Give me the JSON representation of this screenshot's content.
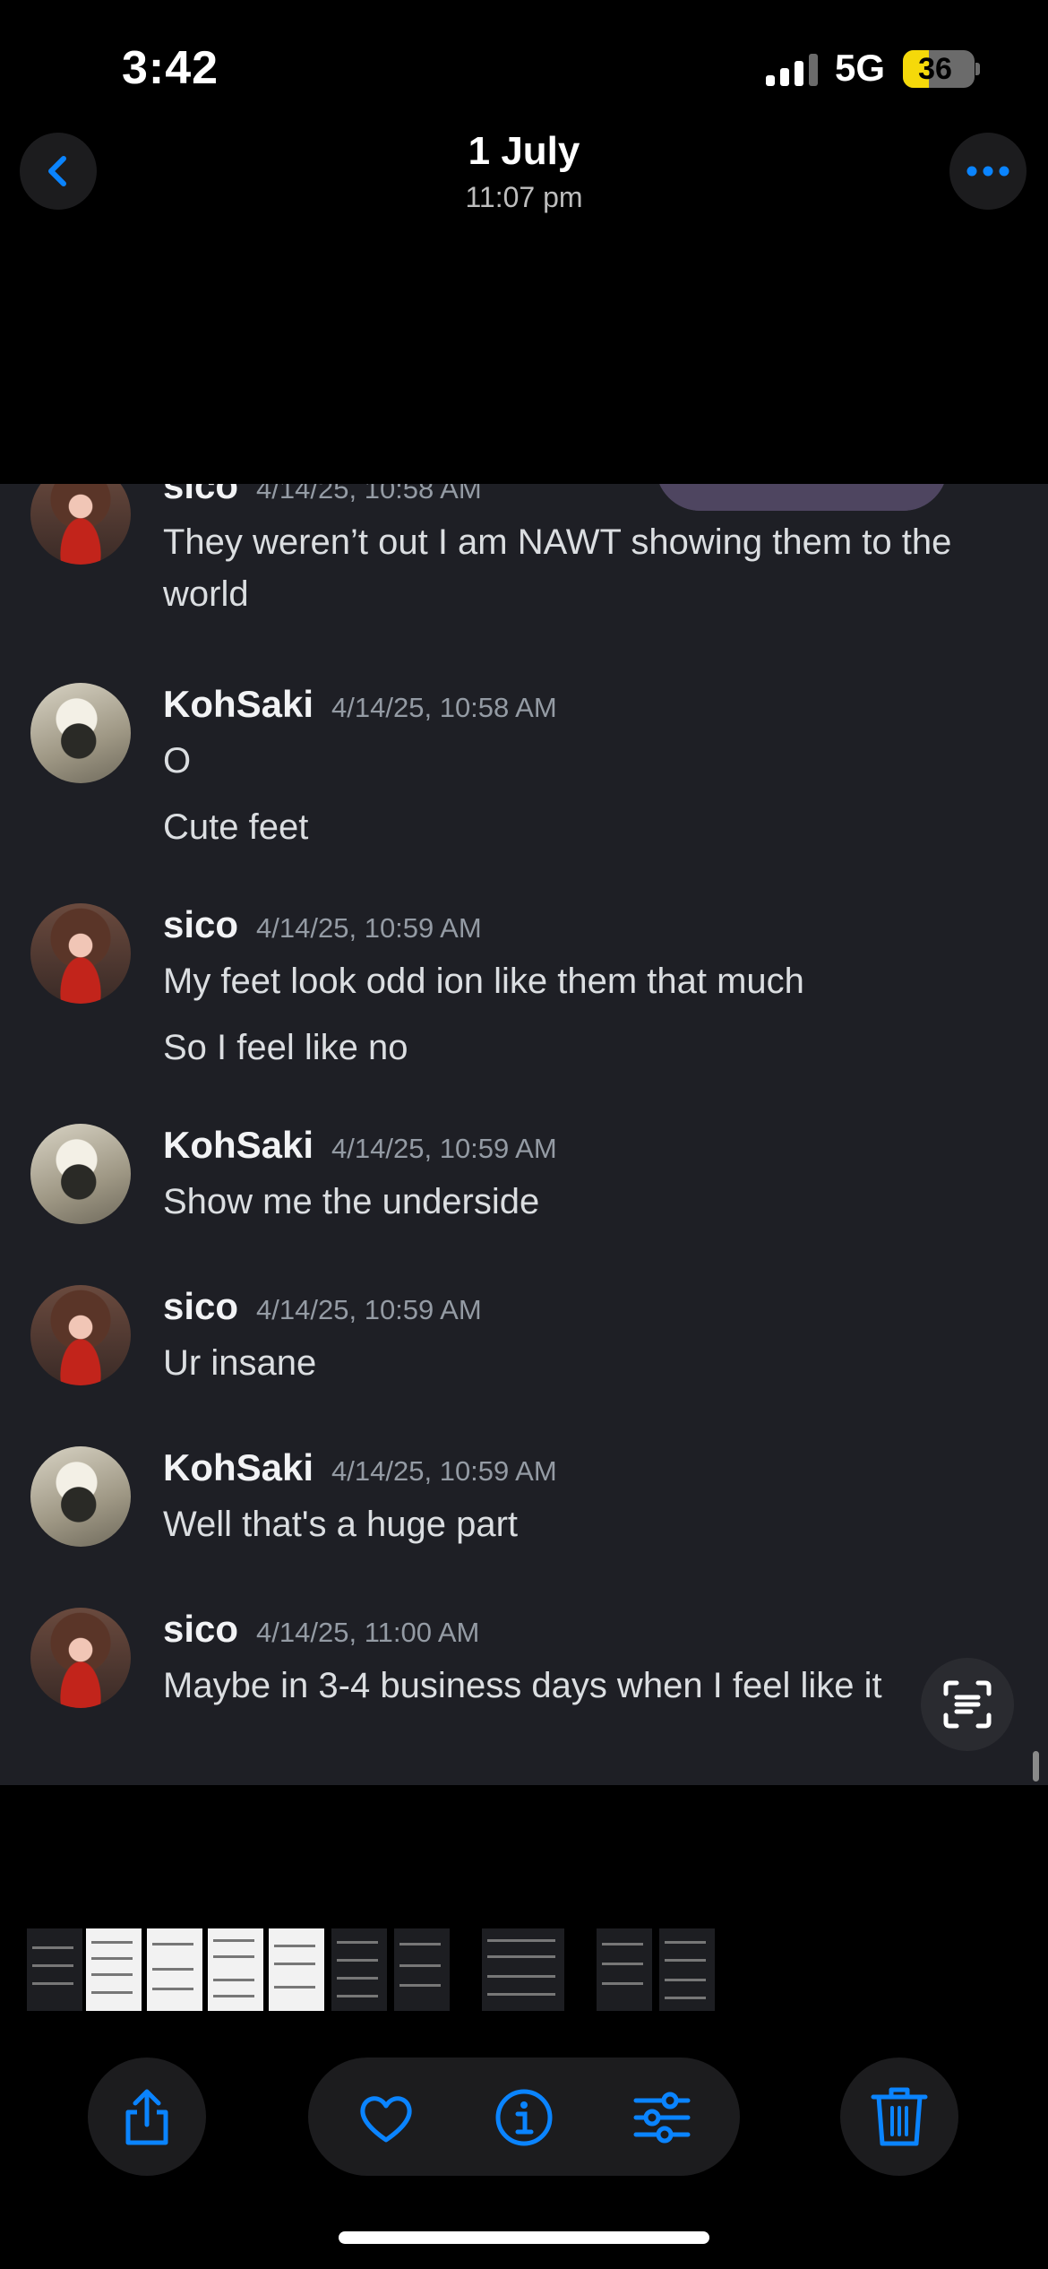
{
  "status_bar": {
    "time": "3:42",
    "network": "5G",
    "battery": "36",
    "battery_level": 0.36
  },
  "header": {
    "date": "1 July",
    "time": "11:07 pm"
  },
  "icons": {
    "back": "chevron-left-icon",
    "more": "ellipsis-icon",
    "share": "share-icon",
    "favorite": "heart-icon",
    "info": "info-icon",
    "adjust": "sliders-icon",
    "delete": "trash-icon",
    "live_text": "live-text-scan-icon"
  },
  "colors": {
    "accent": "#0a84ff",
    "chat_bg": "#1e1f25",
    "timestamp": "#949ba4"
  },
  "messages": [
    {
      "user": "sico",
      "avatar": "sico",
      "timestamp": "4/14/25, 10:58 AM",
      "lines": [
        "They weren’t out I am NAWT showing them to the",
        "world"
      ]
    },
    {
      "user": "KohSaki",
      "avatar": "koh",
      "timestamp": "4/14/25, 10:58 AM",
      "lines": [
        "O",
        "Cute feet"
      ]
    },
    {
      "user": "sico",
      "avatar": "sico",
      "timestamp": "4/14/25, 10:59 AM",
      "lines": [
        "My feet look odd ion like them that much",
        "So I feel like no"
      ]
    },
    {
      "user": "KohSaki",
      "avatar": "koh",
      "timestamp": "4/14/25, 10:59 AM",
      "lines": [
        "Show me the underside"
      ]
    },
    {
      "user": "sico",
      "avatar": "sico",
      "timestamp": "4/14/25, 10:59 AM",
      "lines": [
        "Ur insane"
      ]
    },
    {
      "user": "KohSaki",
      "avatar": "koh",
      "timestamp": "4/14/25, 10:59 AM",
      "lines": [
        "Well that's a huge part"
      ]
    },
    {
      "user": "sico",
      "avatar": "sico",
      "timestamp": "4/14/25, 11:00 AM",
      "lines": [
        "Maybe in 3-4 business days when I feel like it"
      ]
    }
  ]
}
